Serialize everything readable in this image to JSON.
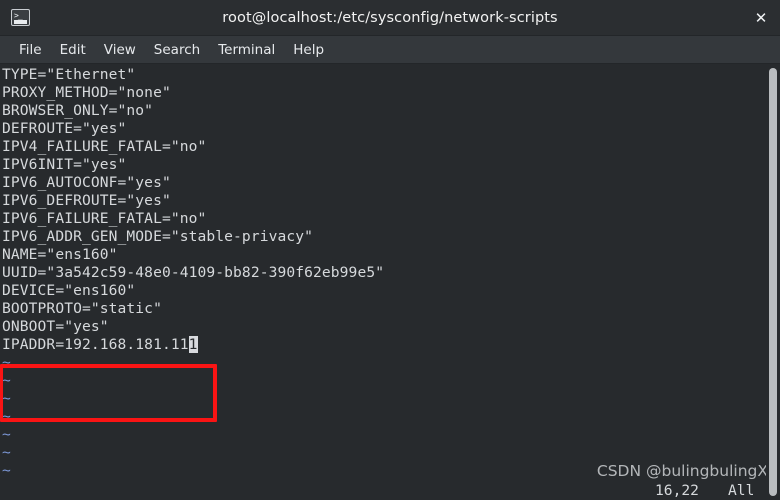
{
  "window": {
    "title": "root@localhost:/etc/sysconfig/network-scripts",
    "app_icon": "terminal-icon",
    "icon_prompt_glyph": ">_",
    "close_glyph": "✕"
  },
  "menubar": {
    "items": [
      {
        "label": "File"
      },
      {
        "label": "Edit"
      },
      {
        "label": "View"
      },
      {
        "label": "Search"
      },
      {
        "label": "Terminal"
      },
      {
        "label": "Help"
      }
    ]
  },
  "editor": {
    "lines": [
      "TYPE=\"Ethernet\"",
      "PROXY_METHOD=\"none\"",
      "BROWSER_ONLY=\"no\"",
      "DEFROUTE=\"yes\"",
      "IPV4_FAILURE_FATAL=\"no\"",
      "IPV6INIT=\"yes\"",
      "IPV6_AUTOCONF=\"yes\"",
      "IPV6_DEFROUTE=\"yes\"",
      "IPV6_FAILURE_FATAL=\"no\"",
      "IPV6_ADDR_GEN_MODE=\"stable-privacy\"",
      "NAME=\"ens160\"",
      "UUID=\"3a542c59-48e0-4109-bb82-390f62eb99e5\"",
      "DEVICE=\"ens160\"",
      "BOOTPROTO=\"static\"",
      "ONBOOT=\"yes\""
    ],
    "cursor_line_prefix": "IPADDR=192.168.181.11",
    "cursor_char": "1",
    "empty_marker": "~",
    "empty_marker_count": 7
  },
  "status": {
    "position": "16,22",
    "scroll": "All"
  },
  "annotation": {
    "box_color": "#fa1414",
    "highlighted_lines": [
      "BOOTPROTO=\"static\"",
      "ONBOOT=\"yes\"",
      "IPADDR=192.168.181.111"
    ]
  },
  "watermark": {
    "text": "CSDN @bulingbulingX"
  },
  "colors": {
    "terminal_bg": "#272a2d",
    "terminal_fg": "#d6d9dc",
    "tilde_fg": "#7b96d4",
    "titlebar_bg": "#2b2e31",
    "menubar_bg": "#34383c",
    "cursor_bg": "#d8dade",
    "accent_red": "#fa1414",
    "scrollbar_thumb": "#b9bcbf"
  }
}
